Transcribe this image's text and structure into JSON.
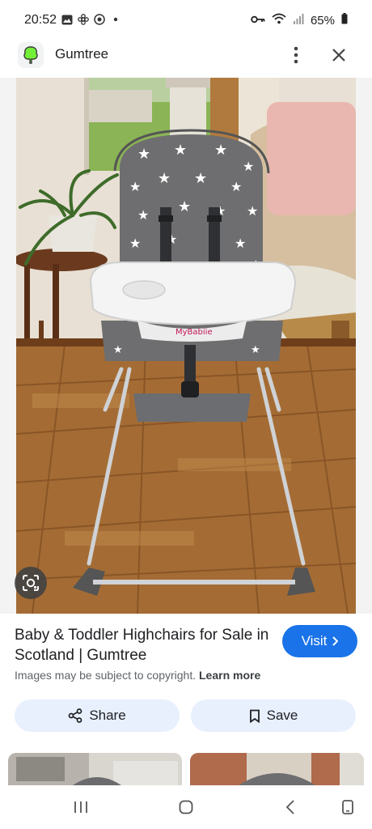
{
  "status_bar": {
    "time": "20:52",
    "battery": "65%",
    "icons_left": [
      "gallery-icon",
      "pinwheel-icon",
      "target-icon",
      "dot-icon"
    ],
    "icons_right": [
      "key-icon",
      "wifi-icon",
      "signal-icon",
      "battery-icon"
    ]
  },
  "header": {
    "title": "Gumtree"
  },
  "image": {
    "brand_text": "MyBabiie"
  },
  "result": {
    "title": "Baby & Toddler Highchairs for Sale in Scotland | Gumtree",
    "visit_label": "Visit",
    "copyright_text": "Images may be subject to copyright.",
    "learn_more": "Learn more",
    "share_label": "Share",
    "save_label": "Save"
  },
  "colors": {
    "accent": "#1a73e8",
    "chip_bg": "#e8f0fe",
    "brand_green": "#72ef36"
  }
}
